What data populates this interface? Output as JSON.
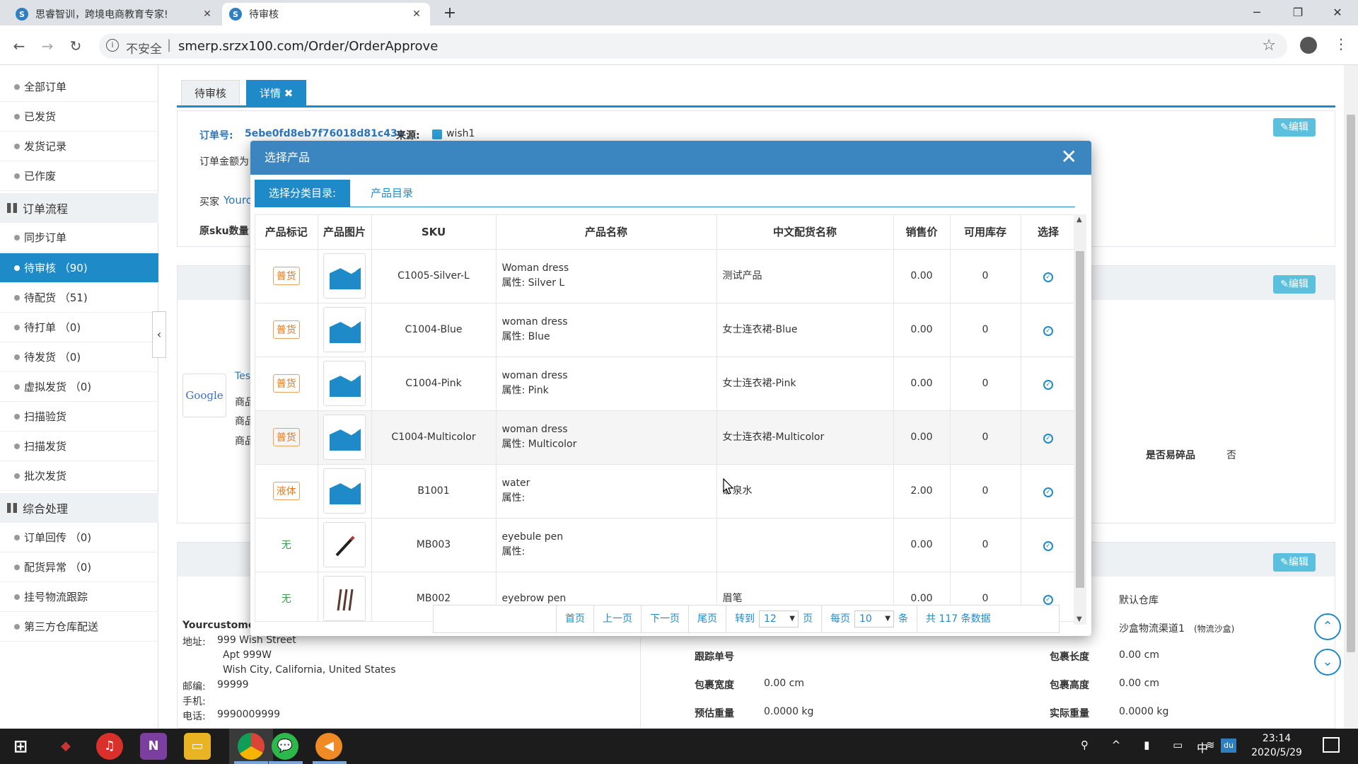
{
  "browser": {
    "tabs": [
      {
        "title": "思睿智训，跨境电商教育专家!",
        "active": false
      },
      {
        "title": "待审核",
        "active": true
      }
    ],
    "insecure_label": "不安全",
    "url": "smerp.srzx100.com/Order/OrderApprove"
  },
  "sidebar": {
    "items_top": [
      "全部订单",
      "已发货",
      "发货记录",
      "已作废"
    ],
    "group_flow": "订单流程",
    "items_flow": [
      "同步订单",
      "待审核 （90)",
      "待配货 （51)",
      "待打单 （0)",
      "待发货 （0)",
      "虚拟发货 （0)",
      "扫描验货",
      "扫描发货",
      "批次发货"
    ],
    "group_misc": "综合处理",
    "items_misc": [
      "订单回传 （0)",
      "配货异常 （0)",
      "挂号物流跟踪",
      "第三方仓库配送"
    ]
  },
  "page": {
    "tabs": [
      "待审核",
      "详情 ✖"
    ],
    "edit_label": "编辑",
    "order_no_label": "订单号:",
    "order_no": "5ebe0fd8eb7f76018d81c43e",
    "source_label": "来源:",
    "source": "wish1",
    "amount_label": "订单金额为",
    "buyer_label": "买家",
    "buyer_name": "Yourc",
    "sku_qty_label": "原sku数量",
    "google_text": "Google",
    "tes_text": "Tes",
    "product_labels": [
      "商品",
      "商品",
      "商品"
    ],
    "fragile_label": "是否易碎品",
    "fragile_value": "否",
    "warehouse": "默认仓库",
    "channel": "沙盒物流渠道1",
    "channel_note": "(物流沙盒)",
    "customer_name": "Yourcustomer",
    "address_label": "地址:",
    "address_lines": [
      "999 Wish Street",
      "Apt 999W",
      "Wish City, California, United States"
    ],
    "zip_label": "邮编:",
    "zip": "99999",
    "mobile_label": "手机:",
    "phone_label": "电话:",
    "phone": "9990009999",
    "tracking_label": "跟踪单号",
    "pkg_length_label": "包裹长度",
    "pkg_length": "0.00 cm",
    "pkg_width_label": "包裹宽度",
    "pkg_width": "0.00 cm",
    "pkg_height_label": "包裹高度",
    "pkg_height": "0.00 cm",
    "est_weight_label": "预估重量",
    "est_weight": "0.0000 kg",
    "act_weight_label": "实际重量",
    "act_weight": "0.0000 kg"
  },
  "modal": {
    "title": "选择产品",
    "tabs": [
      "选择分类目录:",
      "产品目录"
    ],
    "columns": [
      "产品标记",
      "产品图片",
      "SKU",
      "产品名称",
      "中文配货名称",
      "销售价",
      "可用库存",
      "选择"
    ],
    "attr_prefix": "属性:",
    "rows": [
      {
        "tag": "普货",
        "tag_type": "badge",
        "img": "placeholder",
        "sku": "C1005-Silver-L",
        "name": "Woman dress",
        "attr": "属性:  Silver L",
        "cn_name": "测试产品",
        "price": "0.00",
        "stock": "0"
      },
      {
        "tag": "普货",
        "tag_type": "badge",
        "img": "placeholder",
        "sku": "C1004-Blue",
        "name": "woman dress",
        "attr": "属性:  Blue",
        "cn_name": "女士连衣裙-Blue",
        "price": "0.00",
        "stock": "0"
      },
      {
        "tag": "普货",
        "tag_type": "badge",
        "img": "placeholder",
        "sku": "C1004-Pink",
        "name": "woman dress",
        "attr": "属性:  Pink",
        "cn_name": "女士连衣裙-Pink",
        "price": "0.00",
        "stock": "0"
      },
      {
        "tag": "普货",
        "tag_type": "badge",
        "img": "placeholder",
        "sku": "C1004-Multicolor",
        "name": "woman dress",
        "attr": "属性:  Multicolor",
        "cn_name": "女士连衣裙-Multicolor",
        "price": "0.00",
        "stock": "0"
      },
      {
        "tag": "液体",
        "tag_type": "badge",
        "img": "placeholder",
        "sku": "B1001",
        "name": "water",
        "attr": "属性:",
        "cn_name": "矿泉水",
        "price": "2.00",
        "stock": "0"
      },
      {
        "tag": "无",
        "tag_type": "none",
        "img": "pen",
        "sku": "MB003",
        "name": "eyebule pen",
        "attr": "属性:",
        "cn_name": "",
        "price": "0.00",
        "stock": "0"
      },
      {
        "tag": "无",
        "tag_type": "none",
        "img": "brush",
        "sku": "MB002",
        "name": "eyebrow pen",
        "attr": "",
        "cn_name": "眉笔",
        "price": "0.00",
        "stock": "0"
      }
    ],
    "pager": {
      "first": "首页",
      "prev": "上一页",
      "next": "下一页",
      "last": "尾页",
      "goto_label": "转到",
      "goto_value": "12",
      "page_unit": "页",
      "per_page_label": "每页",
      "per_page_value": "10",
      "per_unit": "条",
      "total": "共 117 条数据"
    }
  },
  "taskbar": {
    "time": "23:14",
    "date": "2020/5/29",
    "ime": "中"
  },
  "colors": {
    "primary": "#1f8ac8",
    "modal_header": "#3b85c0",
    "badge": "#e07b1e",
    "none_tag": "#3a9b4e",
    "edit_button": "#5bc0de"
  }
}
